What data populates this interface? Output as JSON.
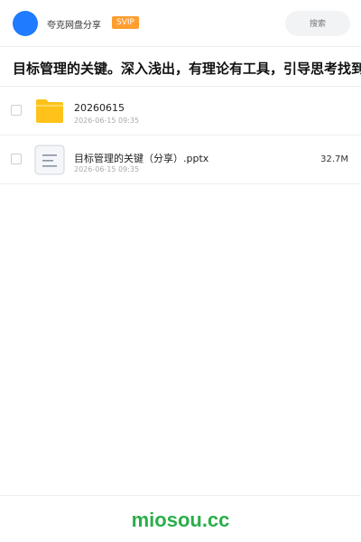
{
  "header": {
    "user_name": "夸克网盘分享",
    "badge": "SVIP",
    "search_placeholder": "搜索"
  },
  "share": {
    "title": "目标管理的关键。深入浅出，有理论有工具，引导思考找到"
  },
  "files": [
    {
      "name": "20260615",
      "date": "2026-06-15 09:35",
      "size": "",
      "type": "folder-icon"
    },
    {
      "name": "目标管理的关键（分享）.pptx",
      "date": "2026-06-15 09:35",
      "size": "32.7M",
      "type": "document-icon"
    }
  ],
  "footer": {
    "brand": "miosou.cc"
  },
  "colors": {
    "avatar": "#1f7bff",
    "badge": "#ff9d2e",
    "folder": "#ffc21a",
    "brand": "#2aae4a"
  }
}
